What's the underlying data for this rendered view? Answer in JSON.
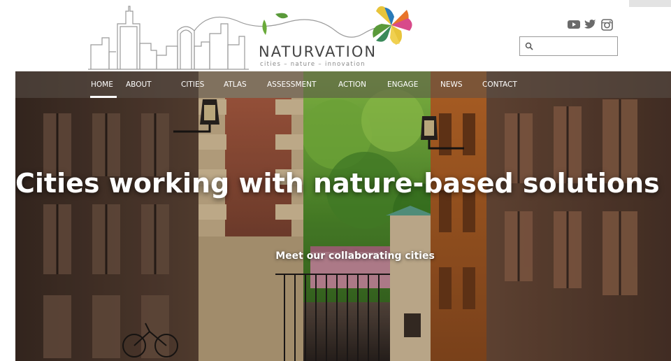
{
  "brand": {
    "name": "NATURVATION",
    "tagline": "cities – nature – innovation"
  },
  "social": [
    "youtube-icon",
    "twitter-icon",
    "instagram-icon"
  ],
  "search": {
    "placeholder": ""
  },
  "nav": {
    "items": [
      {
        "label": "HOME",
        "active": true
      },
      {
        "label": "ABOUT"
      },
      {
        "label": "CITIES"
      },
      {
        "label": "ATLAS"
      },
      {
        "label": "ASSESSMENT"
      },
      {
        "label": "ACTION"
      },
      {
        "label": "ENGAGE"
      },
      {
        "label": "NEWS"
      },
      {
        "label": "CONTACT"
      }
    ]
  },
  "hero": {
    "title": "Cities working with nature-based solutions",
    "link": "Meet our collaborating cities"
  },
  "colors": {
    "nav_bg": "#5a5048",
    "text_white": "#ffffff",
    "logo_orange": "#e8742a",
    "logo_green": "#5a9a3a",
    "logo_blue": "#2a7ab8",
    "logo_yellow": "#e8c43a"
  }
}
